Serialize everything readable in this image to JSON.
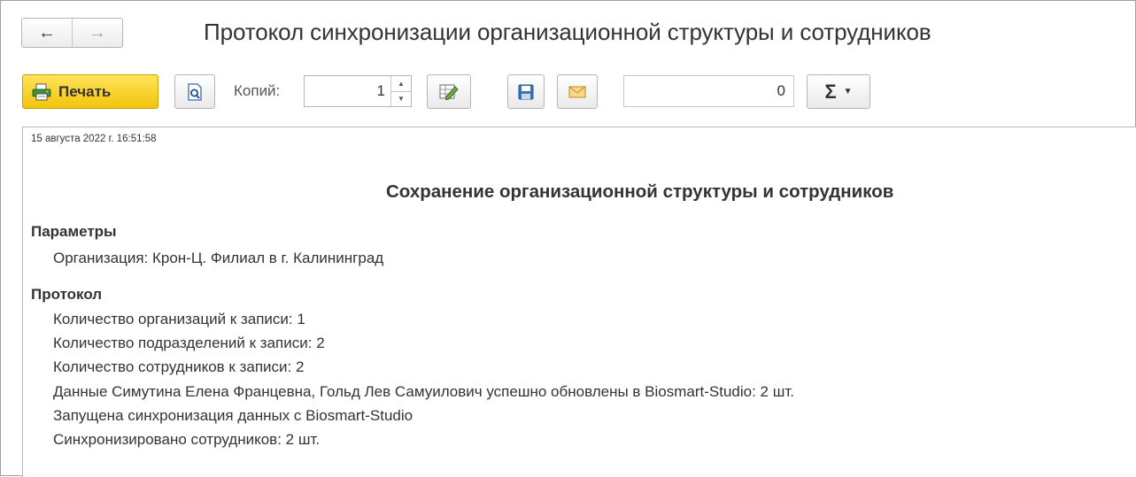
{
  "window": {
    "title": "Протокол синхронизации организационной структуры и сотрудников"
  },
  "nav": {
    "back_icon": "arrow-left-icon",
    "forward_icon": "arrow-right-icon",
    "back_glyph": "←",
    "forward_glyph": "→"
  },
  "toolbar": {
    "print_label": "Печать",
    "copies_label": "Копий:",
    "copies_value": "1",
    "sum_value": "0",
    "sum_glyph": "Σ",
    "sum_caret": "▼",
    "spin_up": "▲",
    "spin_down": "▼",
    "print_color": "#f7cf1e"
  },
  "report": {
    "date": "15 августа 2022 г. 16:51:58",
    "heading": "Сохранение организационной структуры и сотрудников",
    "parameters": {
      "title": "Параметры",
      "lines": [
        "Организация: Крон-Ц. Филиал в г. Калининград"
      ]
    },
    "protocol": {
      "title": "Протокол",
      "lines": [
        "Количество организаций к записи: 1",
        "Количество подразделений к записи: 2",
        "Количество сотрудников к записи: 2",
        "Данные Симутина Елена Францевна, Гольд Лев Самуилович успешно обновлены в Biosmart-Studio: 2 шт.",
        "Запущена синхронизация данных с Biosmart-Studio",
        "Синхронизировано сотрудников: 2 шт."
      ]
    }
  }
}
